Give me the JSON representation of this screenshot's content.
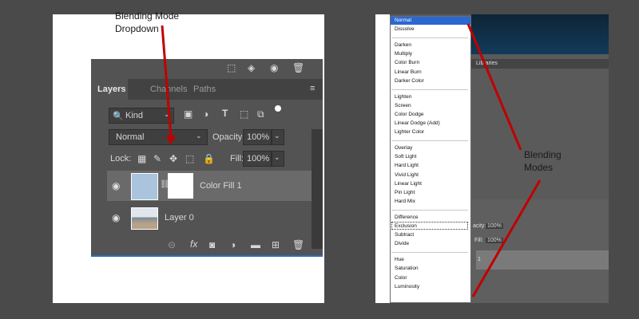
{
  "annotations": {
    "left_line1": "Blending Mode",
    "left_line2": "Dropdown",
    "right_line1": "Blending",
    "right_line2": "Modes"
  },
  "layers_panel": {
    "tabs": [
      "Layers",
      "Channels",
      "Paths"
    ],
    "filter_kind": "Kind",
    "blend_mode": "Normal",
    "opacity_label": "Opacity:",
    "opacity_value": "100%",
    "lock_label": "Lock:",
    "fill_label": "Fill:",
    "fill_value": "100%",
    "layers": [
      {
        "name": "Color Fill 1"
      },
      {
        "name": "Layer 0"
      }
    ],
    "bottom_icons": [
      "link-icon",
      "fx-icon",
      "mask-icon",
      "adjustment-icon",
      "folder-icon",
      "new-layer-icon",
      "trash-icon"
    ]
  },
  "blend_dropdown": {
    "groups": [
      [
        "Normal",
        "Dissolve"
      ],
      [
        "Darken",
        "Multiply",
        "Color Burn",
        "Linear Burn",
        "Darker Color"
      ],
      [
        "Lighten",
        "Screen",
        "Color Dodge",
        "Linear Dodge (Add)",
        "Lighter Color"
      ],
      [
        "Overlay",
        "Soft Light",
        "Hard Light",
        "Vivid Light",
        "Linear Light",
        "Pin Light",
        "Hard Mix"
      ],
      [
        "Difference",
        "Exclusion",
        "Subtract",
        "Divide"
      ],
      [
        "Hue",
        "Saturation",
        "Color",
        "Luminosity"
      ]
    ]
  },
  "right_panel": {
    "header_text": "Libraries",
    "opacity_short": "acity:",
    "opacity_value": "100%",
    "fill_label": "Fill:",
    "fill_value": "100%",
    "layer_num": "1"
  },
  "colors": {
    "annotation_arrow": "#c00000",
    "panel_bg": "#535353",
    "highlight": "#2b67d1"
  }
}
